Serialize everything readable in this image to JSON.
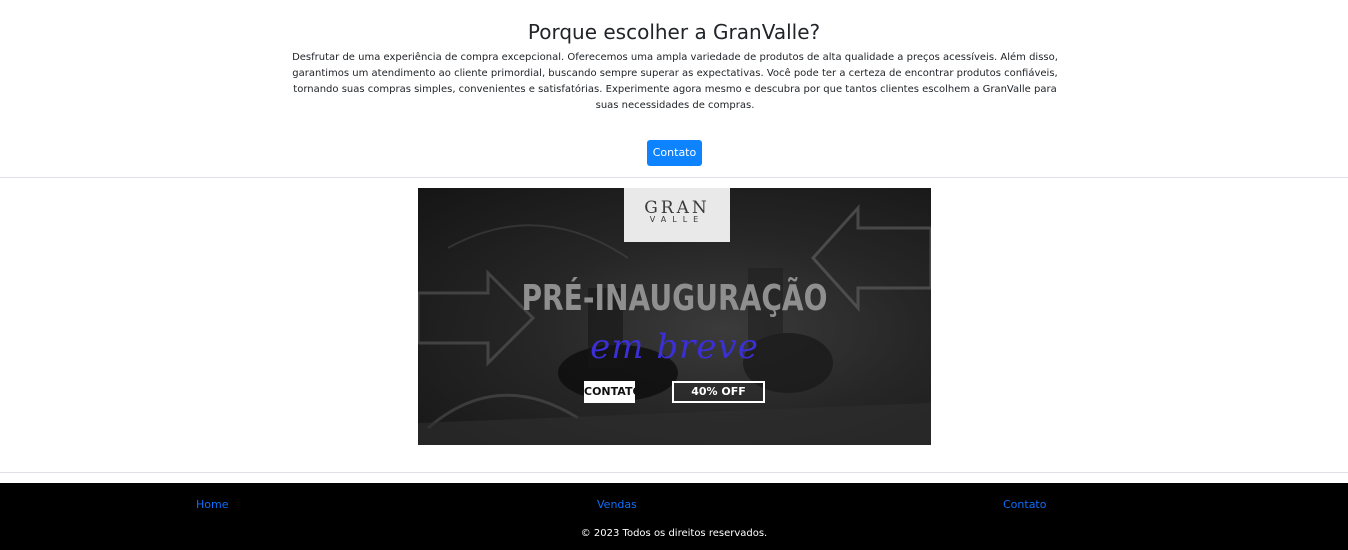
{
  "why": {
    "title": "Porque escolher a GranValle?",
    "text": "Desfrutar de uma experiência de compra excepcional. Oferecemos uma ampla variedade de produtos de alta qualidade a preços acessíveis. Além disso, garantimos um atendimento ao cliente primordial, buscando sempre superar as expectativas. Você pode ter a certeza de encontrar produtos confiáveis, tornando suas compras simples, convenientes e satisfatórias. Experimente agora mesmo e descubra por que tantos clientes escolhem a GranValle para suas necessidades de compras.",
    "button_label": "Contato"
  },
  "banner": {
    "logo_line1": "GRAN",
    "logo_line2": "VALLE",
    "headline": "PRÉ-INAUGURAÇÃO",
    "script_text": "em breve",
    "button1": "CONTATO",
    "button2": "40% OFF"
  },
  "footer": {
    "links": [
      "Home",
      "Vendas",
      "Contato"
    ],
    "copyright": "© 2023 Todos os direitos reservados."
  },
  "colors": {
    "primary_button": "#0d83ff",
    "link": "#0d6efd",
    "footer_bg": "#000000",
    "script_text": "#3b2fd6"
  }
}
